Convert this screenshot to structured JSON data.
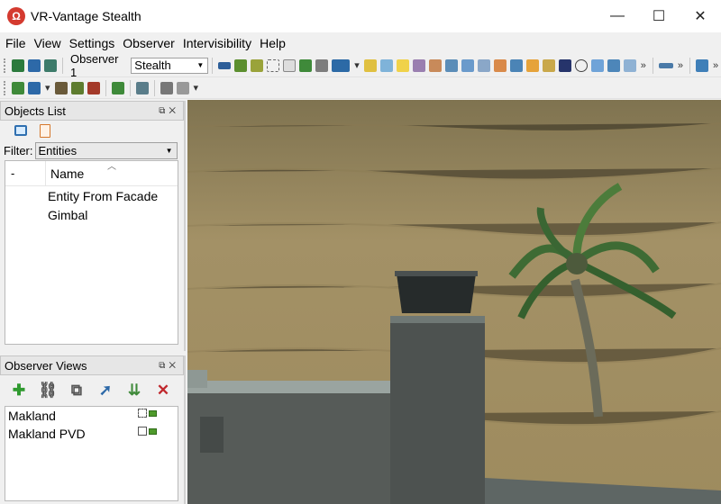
{
  "window": {
    "title": "VR-Vantage Stealth",
    "icon": "app-logo-icon"
  },
  "controls": {
    "minimize": "—",
    "maximize": "☐",
    "close": "✕"
  },
  "menu": [
    "File",
    "View",
    "Settings",
    "Observer",
    "Intervisibility",
    "Help"
  ],
  "toolbar": {
    "observer_label": "Observer 1",
    "observer_mode": "Stealth",
    "overflow": "»"
  },
  "objects_panel": {
    "title": "Objects List",
    "filter_label": "Filter:",
    "filter_value": "Entities",
    "col_dash": "-",
    "col_name": "Name",
    "items": [
      "Entity From Facade",
      "Gimbal"
    ]
  },
  "observer_views_panel": {
    "title": "Observer Views",
    "items": [
      "Makland",
      "Makland PVD"
    ]
  },
  "colors": {
    "accent": "#2f6fb0",
    "ground": "#a08b5c",
    "building": "#5a5e5c"
  }
}
